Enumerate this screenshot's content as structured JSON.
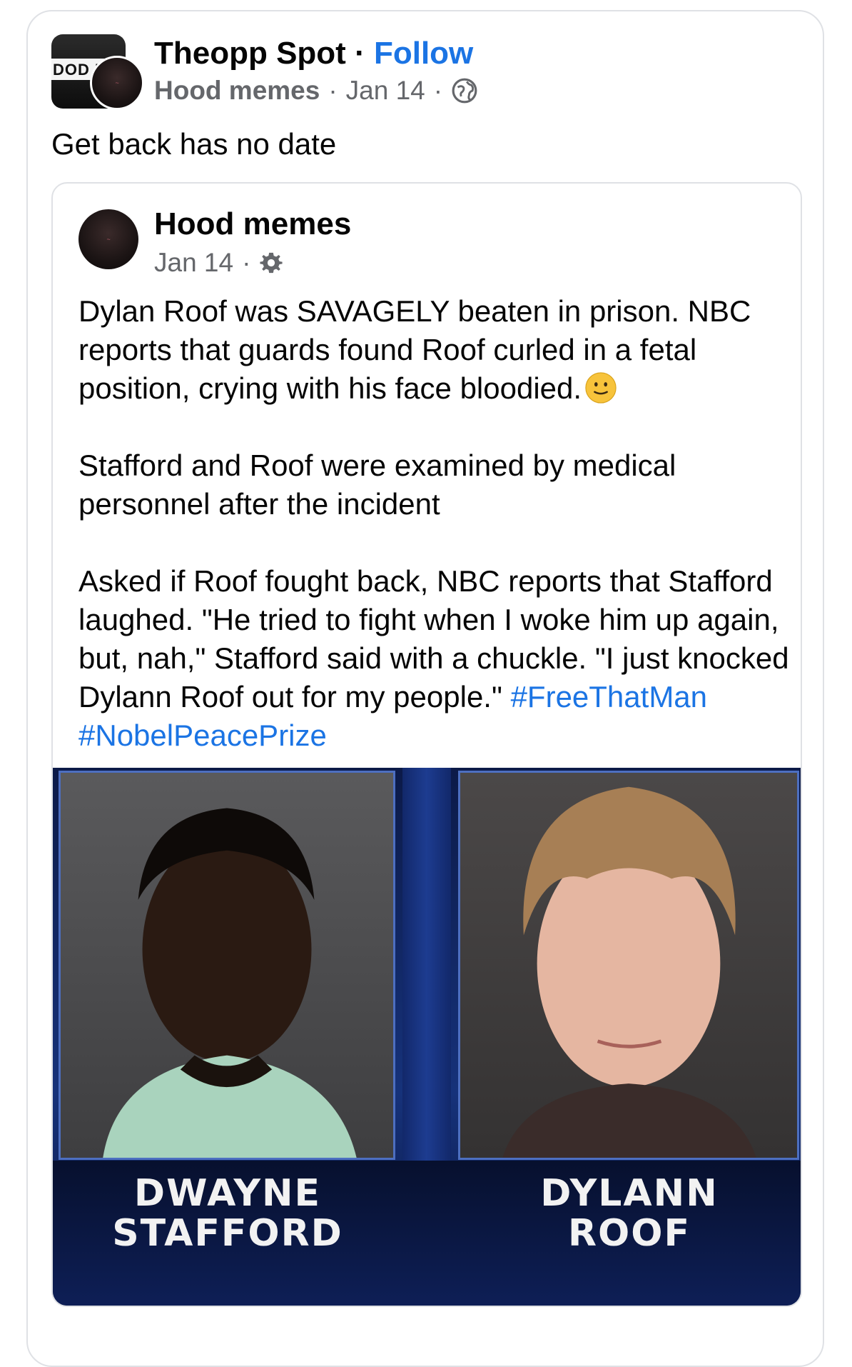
{
  "post": {
    "author": "Theopp Spot",
    "separator": "·",
    "follow_label": "Follow",
    "group": "Hood memes",
    "meta_sep": "·",
    "date": "Jan 14",
    "meta_sep2": "·",
    "audience_icon": "globe-icon",
    "text": "Get back has no date",
    "avatar_text": "DOD N"
  },
  "shared": {
    "author": "Hood memes",
    "date": "Jan 14",
    "meta_sep": "·",
    "audience_icon": "gear-icon",
    "paragraph1": "Dylan Roof was SAVAGELY beaten in prison. NBC reports that guards found Roof curled in a fetal position, crying with his face bloodied.",
    "emoji": "slightly-smiling-face-icon",
    "paragraph2": "Stafford and Roof were examined by medical personnel after the incident",
    "paragraph3": "Asked if Roof fought back, NBC reports that Stafford laughed. \"He tried to fight when I woke him up again, but, nah,\" Stafford said with a chuckle. \"I just knocked Dylann Roof out for my people.\"",
    "hashtag1": "#FreeThatMan",
    "hashtag2": "#NobelPeacePrize"
  },
  "image": {
    "caption_left_line1": "DWAYNE",
    "caption_left_line2": "STAFFORD",
    "caption_right_line1": "DYLANN",
    "caption_right_line2": "ROOF",
    "frame_color": "#16327a",
    "caption_bg": "#0e1f57"
  },
  "colors": {
    "link": "#1b74e4",
    "meta": "#65676b",
    "text": "#050505",
    "border": "#dfe1e5"
  }
}
